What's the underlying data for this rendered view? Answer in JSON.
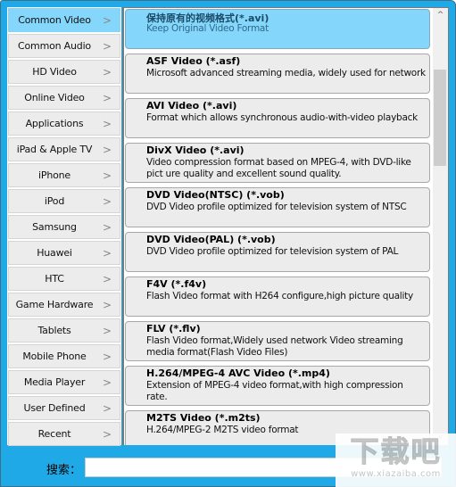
{
  "categories": [
    {
      "label": "Common Video",
      "active": true
    },
    {
      "label": "Common Audio"
    },
    {
      "label": "HD Video"
    },
    {
      "label": "Online Video"
    },
    {
      "label": "Applications"
    },
    {
      "label": "iPad & Apple TV"
    },
    {
      "label": "iPhone"
    },
    {
      "label": "iPod"
    },
    {
      "label": "Samsung"
    },
    {
      "label": "Huawei"
    },
    {
      "label": "HTC"
    },
    {
      "label": "Game Hardware"
    },
    {
      "label": "Tablets"
    },
    {
      "label": "Mobile Phone"
    },
    {
      "label": "Media Player"
    },
    {
      "label": "User Defined"
    },
    {
      "label": "Recent"
    }
  ],
  "chevron_glyph": ">",
  "formats": [
    {
      "title": "保持原有的视频格式(*.avi)",
      "desc": "Keep Original Video Format",
      "active": true
    },
    {
      "title": "ASF Video (*.asf)",
      "desc": "Microsoft advanced streaming media, widely used for network"
    },
    {
      "title": "AVI Video (*.avi)",
      "desc": "Format which allows synchronous audio-with-video playback"
    },
    {
      "title": "DivX Video (*.avi)",
      "desc": "Video compression format based on MPEG-4, with DVD-like pict ure quality and excellent sound quality."
    },
    {
      "title": "DVD Video(NTSC) (*.vob)",
      "desc": "DVD Video profile optimized for television system of NTSC"
    },
    {
      "title": "DVD Video(PAL) (*.vob)",
      "desc": "DVD Video profile optimized for television system of PAL"
    },
    {
      "title": "F4V (*.f4v)",
      "desc": "Flash Video format with H264 configure,high picture quality"
    },
    {
      "title": "FLV (*.flv)",
      "desc": "Flash Video format,Widely used network Video streaming media  format(Flash Video Files)"
    },
    {
      "title": "H.264/MPEG-4 AVC Video (*.mp4)",
      "desc": "Extension of MPEG-4 video format,with high compression rate."
    },
    {
      "title": "M2TS Video (*.m2ts)",
      "desc": "H.264/MPEG-2 M2TS video format"
    }
  ],
  "scrollbar": {
    "up_glyph": "^",
    "down_glyph": "v",
    "thumb_start": 0.115,
    "thumb_fraction": 0.235
  },
  "search": {
    "label": "搜索：",
    "value": "",
    "placeholder": ""
  },
  "watermark": {
    "main": "下载吧",
    "sub": "www.xiazaiba.com"
  }
}
